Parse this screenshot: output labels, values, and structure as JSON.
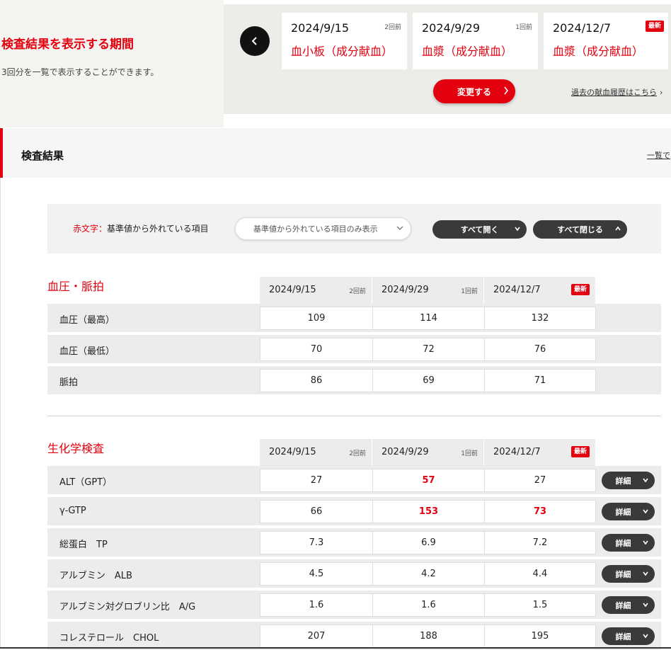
{
  "period": {
    "title": "検査結果を表示する期間",
    "subtitle": "3回分を一覧で表示することができます。",
    "cards": [
      {
        "date": "2024/9/15",
        "type": "血小板（成分献血）",
        "note": "2回前"
      },
      {
        "date": "2024/9/29",
        "type": "血漿（成分献血）",
        "note": "1回前"
      },
      {
        "date": "2024/12/7",
        "type": "血漿（成分献血）",
        "note": "最新"
      }
    ],
    "change_label": "変更する",
    "history_link": "過去の献血履歴はこちら"
  },
  "results": {
    "title": "検査結果",
    "list_link": "一覧で",
    "legend_red": "赤文字：",
    "legend_text": "基準値から外れている項目",
    "filter_label": "基準値から外れている項目のみ表示",
    "open_all": "すべて開く",
    "close_all": "すべて閉じる"
  },
  "columns": [
    {
      "date": "2024/9/15",
      "note": "2回前"
    },
    {
      "date": "2024/9/29",
      "note": "1回前"
    },
    {
      "date": "2024/12/7",
      "note": "最新"
    }
  ],
  "sections": [
    {
      "title": "血圧・脈拍",
      "rows": [
        {
          "label": "血圧（最高）",
          "values": [
            "109",
            "114",
            "132"
          ],
          "alert": [
            false,
            false,
            false
          ]
        },
        {
          "label": "血圧（最低）",
          "values": [
            "70",
            "72",
            "76"
          ],
          "alert": [
            false,
            false,
            false
          ]
        },
        {
          "label": "脈拍",
          "values": [
            "86",
            "69",
            "71"
          ],
          "alert": [
            false,
            false,
            false
          ]
        }
      ]
    },
    {
      "title": "生化学検査",
      "detail_label": "詳細",
      "rows": [
        {
          "label": "ALT（GPT）",
          "values": [
            "27",
            "57",
            "27"
          ],
          "alert": [
            false,
            true,
            false
          ]
        },
        {
          "label": "γ-GTP",
          "values": [
            "66",
            "153",
            "73"
          ],
          "alert": [
            false,
            true,
            true
          ]
        },
        {
          "label": "総蛋白　TP",
          "values": [
            "7.3",
            "6.9",
            "7.2"
          ],
          "alert": [
            false,
            false,
            false
          ]
        },
        {
          "label": "アルブミン　ALB",
          "values": [
            "4.5",
            "4.2",
            "4.4"
          ],
          "alert": [
            false,
            false,
            false
          ]
        },
        {
          "label": "アルブミン対グロブリン比　A/G",
          "values": [
            "1.6",
            "1.6",
            "1.5"
          ],
          "alert": [
            false,
            false,
            false
          ]
        },
        {
          "label": "コレステロール　CHOL",
          "values": [
            "207",
            "188",
            "195"
          ],
          "alert": [
            false,
            false,
            false
          ]
        }
      ]
    }
  ],
  "colors": {
    "accent": "#e3000f",
    "dark_button": "#3a3a3a"
  },
  "icons": {
    "prev": "chevron-left-icon",
    "next": "chevron-right-icon",
    "down": "chevron-down-icon",
    "up": "chevron-up-icon"
  }
}
